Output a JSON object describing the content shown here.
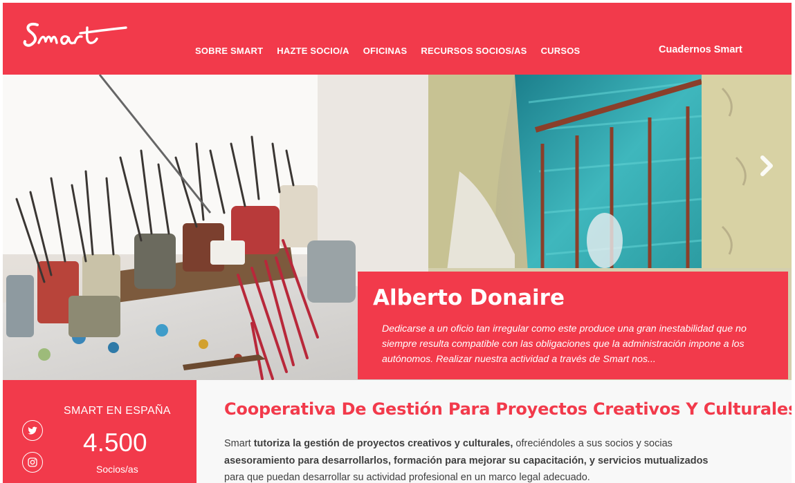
{
  "header": {
    "logo_text": "Smart",
    "nav": [
      "SOBRE SMART",
      "HAZTE SOCIO/A",
      "OFICINAS",
      "RECURSOS SOCIOS/AS",
      "CURSOS"
    ],
    "cuadernos": "Cuadernos Smart"
  },
  "slide": {
    "name": "Alberto Donaire",
    "excerpt": "Dedicarse a un oficio tan irregular como este produce una gran inestabilidad que no siempre resulta compatible con las obligaciones que la administración impone a los autónomos. Realizar nuestra actividad a través de Smart nos..."
  },
  "stats": {
    "title": "SMART EN ESPAÑA",
    "count": "4.500",
    "count_label": "Socios/as"
  },
  "intro": {
    "title": "Cooperativa De Gestión Para Proyectos Creativos Y Culturales",
    "t1": "Smart ",
    "b1": "tutoriza la gestión de proyectos creativos y culturales,",
    "t2": " ofreciéndoles a sus socios y socias ",
    "b2": "asesoramiento para desarrollarlos, formación para mejorar su capacitación, y servicios mutualizados",
    "t3": " para que puedan desarrollar su actividad profesional en un marco legal adecuado."
  },
  "colors": {
    "brand": "#f23a4b",
    "text": "#3f3f3f"
  },
  "icons": [
    "chevron-right-icon",
    "twitter-icon",
    "instagram-icon"
  ]
}
